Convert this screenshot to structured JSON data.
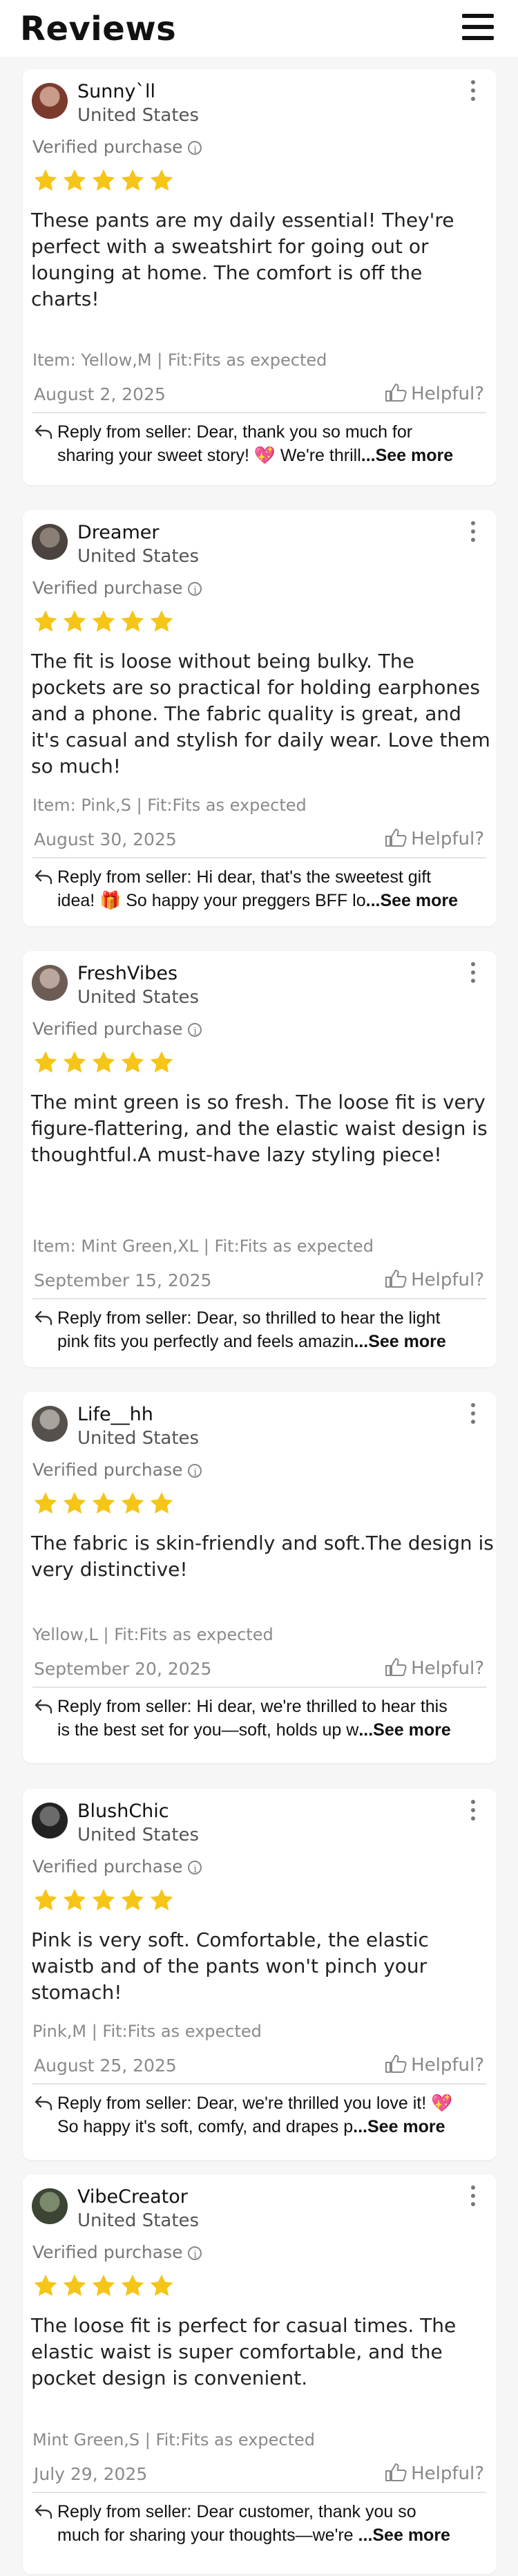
{
  "header": {
    "title": "Reviews",
    "menu_icon": "hamburger-menu-icon"
  },
  "colors": {
    "star": "#f5c518",
    "muted": "#8a8a8a",
    "divider": "#e3e3e3",
    "emoji_heart": "#ff4fa3",
    "gift": "#e03a2f"
  },
  "reviews": [
    {
      "name": "Sunny`ll",
      "country": "United States",
      "verified": "Verified purchase",
      "rating": 5,
      "text": "These pants are my daily essential! They're perfect with a sweatshirt for going out or lounging at home. The comfort is off the charts!",
      "item": "Item: Yellow,M | Fit:Fits as expected",
      "date": "August 2, 2025",
      "helpful": "Helpful?",
      "reply_line1": "Reply from seller: Dear, thank you so much for",
      "reply_line2": "sharing your sweet story! 💖 We're thrill",
      "see_more": "...See more",
      "avatar_colors": [
        "#c99b8a",
        "#7a3a2c"
      ]
    },
    {
      "name": "Dreamer",
      "country": "United States",
      "verified": "Verified purchase",
      "rating": 5,
      "text": "The fit is loose without being bulky. The pockets are so practical for holding earphones and a phone. The fabric quality is great, and it's casual and stylish for daily wear.  Love them so much!",
      "item": "Item: Pink,S | Fit:Fits as expected",
      "date": "August 30, 2025",
      "helpful": "Helpful?",
      "reply_line1": "Reply from seller: Hi dear, that's the sweetest gift",
      "reply_line2": "idea! 🎁 So happy your preggers BFF lo",
      "see_more": "...See more",
      "avatar_colors": [
        "#8a7f76",
        "#4b4340"
      ]
    },
    {
      "name": "FreshVibes",
      "country": "United States",
      "verified": "Verified purchase",
      "rating": 5,
      "text": "The mint green is so fresh. The loose fit is very figure-flattering, and the elastic waist design is thoughtful.A must-have lazy styling piece!",
      "item": "Item: Mint Green,XL | Fit:Fits as expected",
      "date": "September 15, 2025",
      "helpful": "Helpful?",
      "reply_line1": "Reply from seller: Dear, so thrilled to hear the light",
      "reply_line2": "pink fits you perfectly and feels amazin",
      "see_more": "...See more",
      "avatar_colors": [
        "#b9a79d",
        "#6c5c55"
      ]
    },
    {
      "name": "Life__hh",
      "country": "United States",
      "verified": "Verified purchase",
      "rating": 5,
      "text": "The fabric is skin-friendly and soft.The design is very distinctive!",
      "item": "Yellow,L | Fit:Fits as expected",
      "date": "September 20, 2025",
      "helpful": "Helpful?",
      "reply_line1": "Reply from seller: Hi dear, we're thrilled to hear this",
      "reply_line2": "is the best set for you—soft, holds up w",
      "see_more": "...See more",
      "avatar_colors": [
        "#a8a39d",
        "#55504c"
      ]
    },
    {
      "name": "BlushChic",
      "country": "United States",
      "verified": "Verified purchase",
      "rating": 5,
      "text": "Pink is very soft. Comfortable, the elastic waistb and of the pants won't pinch your stomach!",
      "item": "Pink,M | Fit:Fits as expected",
      "date": "August 25, 2025",
      "helpful": "Helpful?",
      "reply_line1": "Reply from seller: Dear, we're thrilled you love it! 💖",
      "reply_line2": "So happy it's soft, comfy, and drapes p",
      "see_more": "...See more",
      "avatar_colors": [
        "#6b6b6b",
        "#222222"
      ]
    },
    {
      "name": "VibeCreator",
      "country": "United States",
      "verified": "Verified purchase",
      "rating": 5,
      "text": "The loose fit is perfect for casual times. The elastic waist is super comfortable, and the pocket design is convenient.",
      "item": "Mint Green,S | Fit:Fits as expected",
      "date": "July 29, 2025",
      "helpful": "Helpful?",
      "reply_line1": "Reply from seller: Dear customer, thank you so",
      "reply_line2": "much for sharing your thoughts—we're ",
      "see_more": "...See more",
      "avatar_colors": [
        "#7b8a6c",
        "#3c4434"
      ]
    }
  ]
}
